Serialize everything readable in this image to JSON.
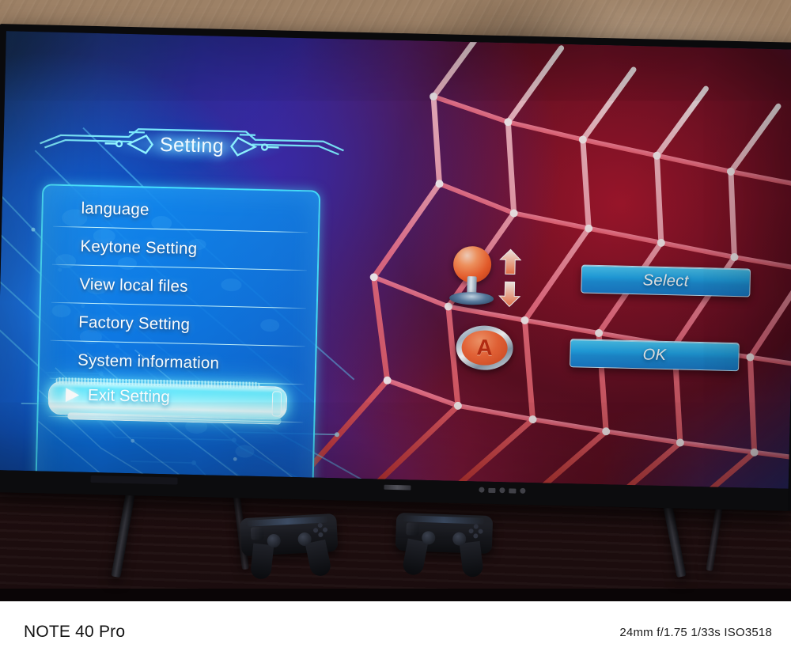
{
  "caption": {
    "model": "NOTE 40 Pro",
    "exif": "24mm f/1.75 1/33s ISO3518"
  },
  "screen": {
    "header": {
      "title": "Setting"
    },
    "menu": {
      "items": [
        {
          "label": "language",
          "selected": false
        },
        {
          "label": "Keytone Setting",
          "selected": false
        },
        {
          "label": "View local files",
          "selected": false
        },
        {
          "label": "Factory Setting",
          "selected": false
        },
        {
          "label": "System information",
          "selected": false
        },
        {
          "label": "Exit Setting",
          "selected": true
        }
      ],
      "selected_index": 5,
      "selection_marker": "right-arrow"
    },
    "hints": {
      "joystick_icon": "arcade-joystick-icon",
      "arrow_up_icon": "arrow-up-icon",
      "arrow_down_icon": "arrow-down-icon",
      "a_button_label": "A"
    },
    "buttons": [
      {
        "label": "Select",
        "name": "select-button"
      },
      {
        "label": "OK",
        "name": "ok-button"
      }
    ],
    "colors": {
      "panel_border": "#46e2ff",
      "panel_fill": "#0e7ae4",
      "highlight": "#5eeaff",
      "button_blue": "#22a8ec",
      "accent_red": "#f4693a",
      "title_text": "#f2fbff"
    }
  },
  "scene": {
    "device": "flat-screen-tv",
    "wall_color": "#9b8066",
    "table_color": "#2a1313",
    "controllers": 2
  }
}
